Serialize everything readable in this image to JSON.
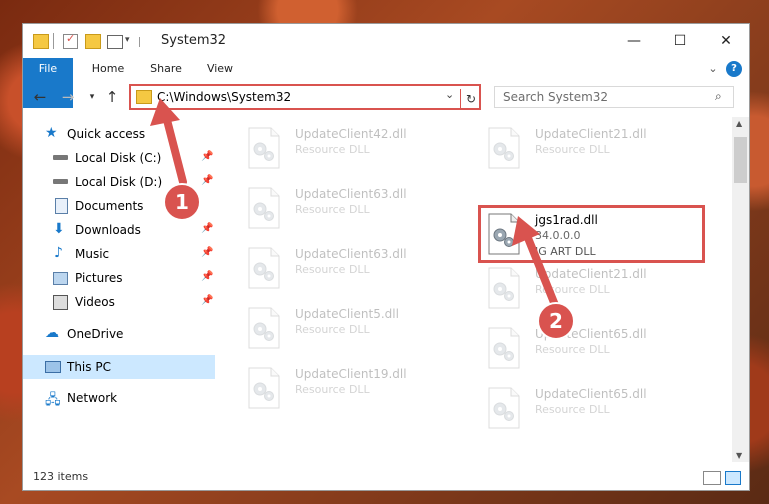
{
  "window": {
    "title": "System32",
    "controls": {
      "minimize": "—",
      "maximize": "☐",
      "close": "✕"
    }
  },
  "ribbon": {
    "tabs": [
      {
        "label": "File"
      },
      {
        "label": "Home"
      },
      {
        "label": "Share"
      },
      {
        "label": "View"
      }
    ]
  },
  "address": {
    "path": "C:\\Windows\\System32"
  },
  "search": {
    "placeholder": "Search System32"
  },
  "nav": {
    "quick_access": "Quick access",
    "items": [
      {
        "label": "Local Disk (C:)",
        "icon": "drive-icon",
        "pinned": true
      },
      {
        "label": "Local Disk (D:)",
        "icon": "drive-icon",
        "pinned": true
      },
      {
        "label": "Documents",
        "icon": "documents-icon",
        "pinned": false
      },
      {
        "label": "Downloads",
        "icon": "download-icon",
        "pinned": true
      },
      {
        "label": "Music",
        "icon": "music-icon",
        "pinned": true
      },
      {
        "label": "Pictures",
        "icon": "pictures-icon",
        "pinned": true
      },
      {
        "label": "Videos",
        "icon": "videos-icon",
        "pinned": true
      }
    ],
    "onedrive": "OneDrive",
    "this_pc": "This PC",
    "network": "Network"
  },
  "files": {
    "left": [
      {
        "name": "UpdateClient42.dll",
        "desc": "Resource DLL"
      },
      {
        "name": "UpdateClient63.dll",
        "desc": "Resource DLL"
      },
      {
        "name": "UpdateClient63.dll",
        "desc": "Resource DLL"
      },
      {
        "name": "UpdateClient5.dll",
        "desc": "Resource DLL"
      },
      {
        "name": "UpdateClient19.dll",
        "desc": "Resource DLL"
      }
    ],
    "right": [
      {
        "name": "UpdateClient21.dll",
        "desc": "Resource DLL"
      },
      {
        "name": "jgs1rad.dll",
        "version": "34.0.0.0",
        "desc": "JG ART DLL",
        "highlighted": true
      },
      {
        "name": "UpdateClient21.dll",
        "desc": "Resource DLL"
      },
      {
        "name": "UpdateClient65.dll",
        "desc": "Resource DLL"
      },
      {
        "name": "UpdateClient65.dll",
        "desc": "Resource DLL"
      }
    ]
  },
  "status": {
    "count": "123 items"
  },
  "annotations": {
    "step1": "1",
    "step2": "2"
  },
  "colors": {
    "accent": "#1979ca",
    "highlight": "#d9534f",
    "selected": "#cce8ff"
  }
}
